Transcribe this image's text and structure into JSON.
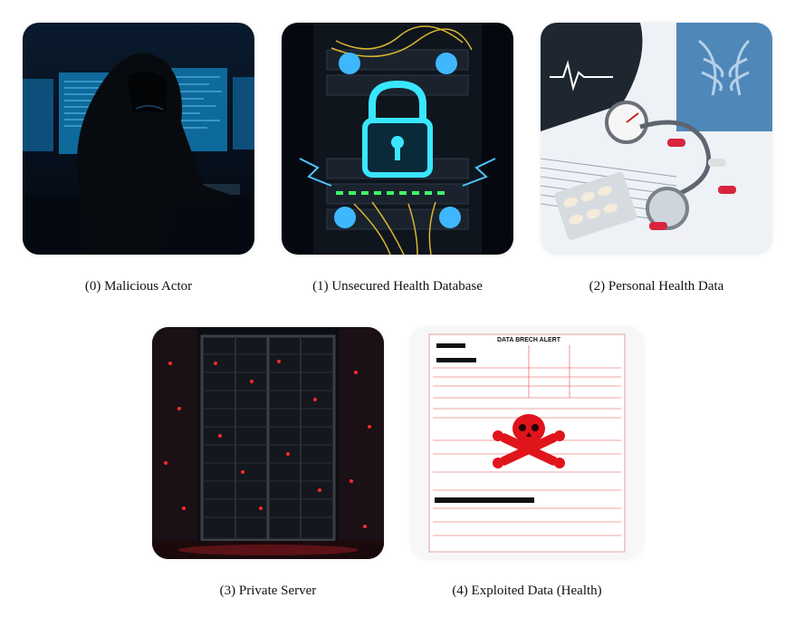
{
  "nodes": [
    {
      "id": 0,
      "caption": "(0) Malicious Actor",
      "image": "hooded-hacker-image"
    },
    {
      "id": 1,
      "caption": "(1) Unsecured Health Database",
      "image": "server-rack-padlock-image"
    },
    {
      "id": 2,
      "caption": "(2) Personal Health Data",
      "image": "medical-records-stethoscope-image"
    },
    {
      "id": 3,
      "caption": "(3) Private Server",
      "image": "datacenter-server-image"
    },
    {
      "id": 4,
      "caption": "(4) Exploited Data (Health)",
      "image": "breach-document-skull-image",
      "doc_title": "DATA BRECH ALERT"
    }
  ]
}
